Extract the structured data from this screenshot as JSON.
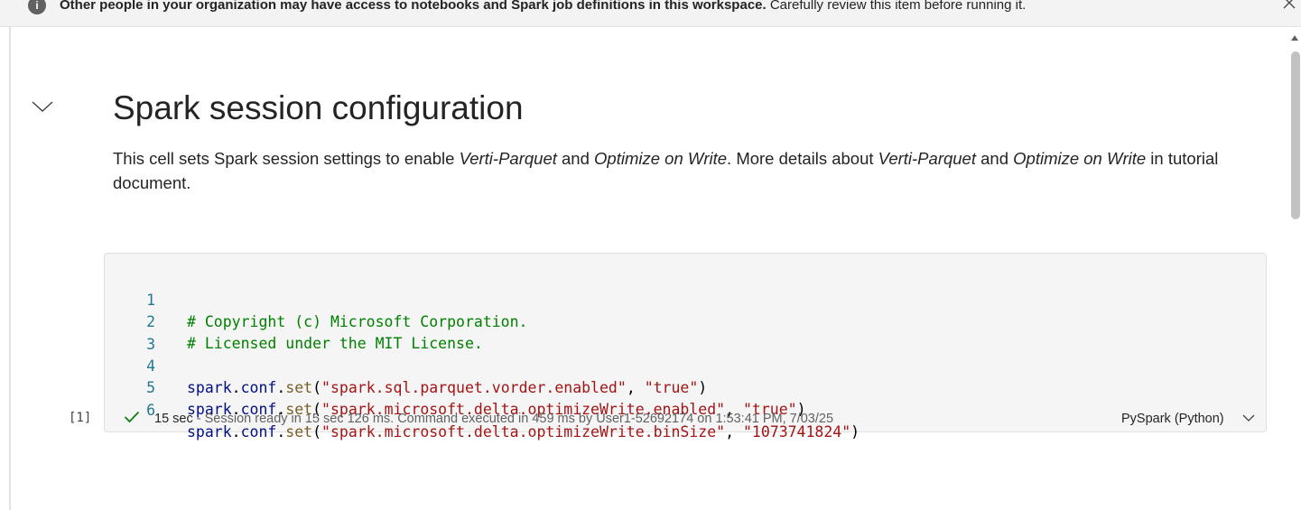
{
  "banner": {
    "bold_text": "Other people in your organization may have access to notebooks and Spark job definitions in this workspace.",
    "text": "Carefully review this item before running it.",
    "icon": "info-icon",
    "close_icon": "close-icon"
  },
  "markdown_cell": {
    "title": "Spark session configuration",
    "body_parts": [
      "This cell sets Spark session settings to enable ",
      "Verti-Parquet",
      " and ",
      "Optimize on Write",
      ". More details about ",
      "Verti-Parquet",
      " and ",
      "Optimize on Write",
      " in tutorial document."
    ]
  },
  "code_cell": {
    "execution_count": "[1]",
    "lines": [
      {
        "num": "1",
        "comment": "# Copyright (c) Microsoft Corporation."
      },
      {
        "num": "2",
        "comment": "# Licensed under the MIT License."
      },
      {
        "num": "3"
      },
      {
        "num": "4",
        "var": "spark",
        "attr": "conf",
        "fn": "set",
        "key": "\"spark.sql.parquet.vorder.enabled\"",
        "val": "\"true\""
      },
      {
        "num": "5",
        "var": "spark",
        "attr": "conf",
        "fn": "set",
        "key": "\"spark.microsoft.delta.optimizeWrite.enabled\"",
        "val": "\"true\""
      },
      {
        "num": "6",
        "var": "spark",
        "attr": "conf",
        "fn": "set",
        "key": "\"spark.microsoft.delta.optimizeWrite.binSize\"",
        "val": "\"1073741824\""
      }
    ],
    "status": {
      "duration": "15 sec",
      "detail": " - Session ready in 15 sec 126 ms. Command executed in 459 ms by User1-52692174 on 1:53:41 PM, 7/03/25"
    },
    "language": "PySpark (Python)"
  },
  "colors": {
    "comment": "#008000",
    "string": "#a31515",
    "variable": "#001080",
    "function": "#795e26",
    "line_number": "#237893",
    "success": "#107c10"
  }
}
